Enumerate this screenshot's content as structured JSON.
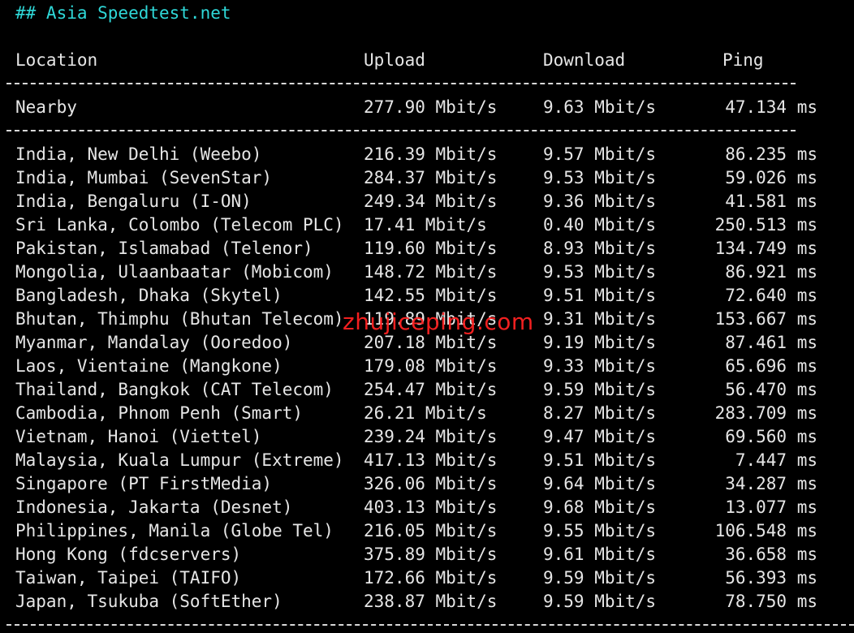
{
  "heading": "## Asia Speedtest.net",
  "headers": {
    "location": "Location",
    "upload": "Upload",
    "download": "Download",
    "ping": "Ping"
  },
  "nearby": {
    "location": "Nearby",
    "upload": "277.90 Mbit/s",
    "download": "9.63 Mbit/s",
    "ping": "47.134 ms"
  },
  "rows": [
    {
      "location": "India, New Delhi (Weebo)",
      "upload": "216.39 Mbit/s",
      "download": "9.57 Mbit/s",
      "ping": "86.235 ms"
    },
    {
      "location": "India, Mumbai (SevenStar)",
      "upload": "284.37 Mbit/s",
      "download": "9.53 Mbit/s",
      "ping": "59.026 ms"
    },
    {
      "location": "India, Bengaluru (I-ON)",
      "upload": "249.34 Mbit/s",
      "download": "9.36 Mbit/s",
      "ping": "41.581 ms"
    },
    {
      "location": "Sri Lanka, Colombo (Telecom PLC)",
      "upload": "17.41 Mbit/s",
      "download": "0.40 Mbit/s",
      "ping": "250.513 ms"
    },
    {
      "location": "Pakistan, Islamabad (Telenor)",
      "upload": "119.60 Mbit/s",
      "download": "8.93 Mbit/s",
      "ping": "134.749 ms"
    },
    {
      "location": "Mongolia, Ulaanbaatar (Mobicom)",
      "upload": "148.72 Mbit/s",
      "download": "9.53 Mbit/s",
      "ping": "86.921 ms"
    },
    {
      "location": "Bangladesh, Dhaka (Skytel)",
      "upload": "142.55 Mbit/s",
      "download": "9.51 Mbit/s",
      "ping": "72.640 ms"
    },
    {
      "location": "Bhutan, Thimphu (Bhutan Telecom)",
      "upload": "119.89 Mbit/s",
      "download": "9.31 Mbit/s",
      "ping": "153.667 ms"
    },
    {
      "location": "Myanmar, Mandalay (Ooredoo)",
      "upload": "207.18 Mbit/s",
      "download": "9.19 Mbit/s",
      "ping": "87.461 ms"
    },
    {
      "location": "Laos, Vientaine (Mangkone)",
      "upload": "179.08 Mbit/s",
      "download": "9.33 Mbit/s",
      "ping": "65.696 ms"
    },
    {
      "location": "Thailand, Bangkok (CAT Telecom)",
      "upload": "254.47 Mbit/s",
      "download": "9.59 Mbit/s",
      "ping": "56.470 ms"
    },
    {
      "location": "Cambodia, Phnom Penh (Smart)",
      "upload": "26.21 Mbit/s",
      "download": "8.27 Mbit/s",
      "ping": "283.709 ms"
    },
    {
      "location": "Vietnam, Hanoi (Viettel)",
      "upload": "239.24 Mbit/s",
      "download": "9.47 Mbit/s",
      "ping": "69.560 ms"
    },
    {
      "location": "Malaysia, Kuala Lumpur (Extreme)",
      "upload": "417.13 Mbit/s",
      "download": "9.51 Mbit/s",
      "ping": "7.447 ms"
    },
    {
      "location": "Singapore (PT FirstMedia)",
      "upload": "326.06 Mbit/s",
      "download": "9.64 Mbit/s",
      "ping": "34.287 ms"
    },
    {
      "location": "Indonesia, Jakarta (Desnet)",
      "upload": "403.13 Mbit/s",
      "download": "9.68 Mbit/s",
      "ping": "13.077 ms"
    },
    {
      "location": "Philippines, Manila (Globe Tel)",
      "upload": "216.05 Mbit/s",
      "download": "9.55 Mbit/s",
      "ping": "106.548 ms"
    },
    {
      "location": "Hong Kong (fdcservers)",
      "upload": "375.89 Mbit/s",
      "download": "9.61 Mbit/s",
      "ping": "36.658 ms"
    },
    {
      "location": "Taiwan, Taipei (TAIFO)",
      "upload": "172.66 Mbit/s",
      "download": "9.59 Mbit/s",
      "ping": "56.393 ms"
    },
    {
      "location": "Japan, Tsukuba (SoftEther)",
      "upload": "238.87 Mbit/s",
      "download": "9.59 Mbit/s",
      "ping": "78.750 ms"
    }
  ],
  "watermark": "zhujiceping.com",
  "colors": {
    "background": "#000000",
    "text": "#e6e6e6",
    "heading": "#2fd8d8",
    "watermark": "#ff2222"
  }
}
